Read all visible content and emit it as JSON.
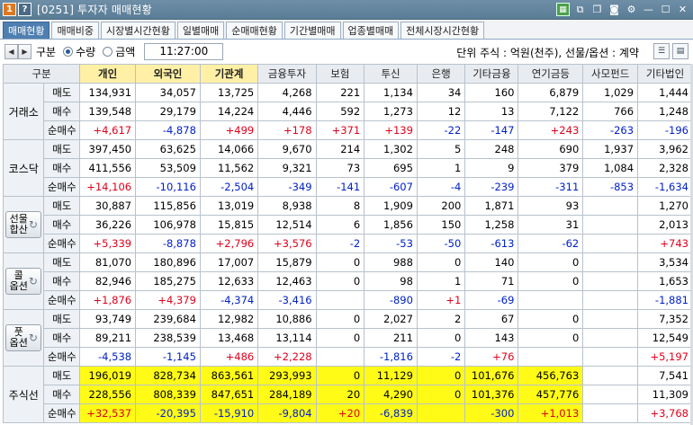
{
  "window": {
    "badge1": "1",
    "badge2": "?",
    "title": "[0251] 투자자 매매현황"
  },
  "tabs": [
    "매매현황",
    "매매비중",
    "시장별시간현황",
    "일별매매",
    "순매매현황",
    "기간별매매",
    "업종별매매",
    "전체시장시간현황"
  ],
  "toolbar": {
    "gubun_label": "구분",
    "radio_qty": "수량",
    "radio_amt": "금액",
    "time": "11:27:00",
    "unit_text": "단위 주식 : 억원(천주), 선물/옵션 : 계약"
  },
  "columns": [
    "구분",
    "개인",
    "외국인",
    "기관계",
    "금융투자",
    "보험",
    "투신",
    "은행",
    "기타금융",
    "연기금등",
    "사모펀드",
    "기타법인"
  ],
  "row_labels": [
    "매도",
    "매수",
    "순매수"
  ],
  "groups": [
    {
      "name": "거래소",
      "button": false,
      "rows": [
        [
          "134,931",
          "34,057",
          "13,725",
          "4,268",
          "221",
          "1,134",
          "34",
          "160",
          "6,879",
          "1,029",
          "1,444"
        ],
        [
          "139,548",
          "29,179",
          "14,224",
          "4,446",
          "592",
          "1,273",
          "12",
          "13",
          "7,122",
          "766",
          "1,248"
        ],
        [
          "+4,617",
          "-4,878",
          "+499",
          "+178",
          "+371",
          "+139",
          "-22",
          "-147",
          "+243",
          "-263",
          "-196"
        ]
      ]
    },
    {
      "name": "코스닥",
      "button": false,
      "rows": [
        [
          "397,450",
          "63,625",
          "14,066",
          "9,670",
          "214",
          "1,302",
          "5",
          "248",
          "690",
          "1,937",
          "3,962"
        ],
        [
          "411,556",
          "53,509",
          "11,562",
          "9,321",
          "73",
          "695",
          "1",
          "9",
          "379",
          "1,084",
          "2,328"
        ],
        [
          "+14,106",
          "-10,116",
          "-2,504",
          "-349",
          "-141",
          "-607",
          "-4",
          "-239",
          "-311",
          "-853",
          "-1,634"
        ]
      ]
    },
    {
      "name": "선물 합산",
      "line1": "선물",
      "line2": "합산",
      "button": true,
      "rows": [
        [
          "30,887",
          "115,856",
          "13,019",
          "8,938",
          "8",
          "1,909",
          "200",
          "1,871",
          "93",
          "",
          "1,270"
        ],
        [
          "36,226",
          "106,978",
          "15,815",
          "12,514",
          "6",
          "1,856",
          "150",
          "1,258",
          "31",
          "",
          "2,013"
        ],
        [
          "+5,339",
          "-8,878",
          "+2,796",
          "+3,576",
          "-2",
          "-53",
          "-50",
          "-613",
          "-62",
          "",
          "+743"
        ]
      ]
    },
    {
      "name": "콜 옵션",
      "line1": "콜",
      "line2": "옵션",
      "button": true,
      "rows": [
        [
          "81,070",
          "180,896",
          "17,007",
          "15,879",
          "0",
          "988",
          "0",
          "140",
          "0",
          "",
          "3,534"
        ],
        [
          "82,946",
          "185,275",
          "12,633",
          "12,463",
          "0",
          "98",
          "1",
          "71",
          "0",
          "",
          "1,653"
        ],
        [
          "+1,876",
          "+4,379",
          "-4,374",
          "-3,416",
          "",
          "-890",
          "+1",
          "-69",
          "",
          "",
          "-1,881"
        ]
      ]
    },
    {
      "name": "풋 옵션",
      "line1": "풋",
      "line2": "옵션",
      "button": true,
      "rows": [
        [
          "93,749",
          "239,684",
          "12,982",
          "10,886",
          "0",
          "2,027",
          "2",
          "67",
          "0",
          "",
          "7,352"
        ],
        [
          "89,211",
          "238,539",
          "13,468",
          "13,114",
          "0",
          "211",
          "0",
          "143",
          "0",
          "",
          "12,549"
        ],
        [
          "-4,538",
          "-1,145",
          "+486",
          "+2,228",
          "",
          "-1,816",
          "-2",
          "+76",
          "",
          "",
          "+5,197"
        ]
      ]
    },
    {
      "name": "주식선",
      "button": false,
      "highlight": true,
      "rows": [
        [
          "196,019",
          "828,734",
          "863,561",
          "293,993",
          "0",
          "11,129",
          "0",
          "101,676",
          "456,763",
          "",
          "7,541"
        ],
        [
          "228,556",
          "808,339",
          "847,651",
          "284,189",
          "20",
          "4,290",
          "0",
          "101,376",
          "457,776",
          "",
          "11,309"
        ],
        [
          "+32,537",
          "-20,395",
          "-15,910",
          "-9,804",
          "+20",
          "-6,839",
          "",
          "-300",
          "+1,013",
          "",
          "+3,768"
        ]
      ]
    }
  ],
  "colors": {
    "positive": "#e0001a",
    "negative": "#0020c8",
    "highlight": "#fffb16",
    "header_highlight": "#fff0a6",
    "active_tab": "#4f7fb0"
  }
}
